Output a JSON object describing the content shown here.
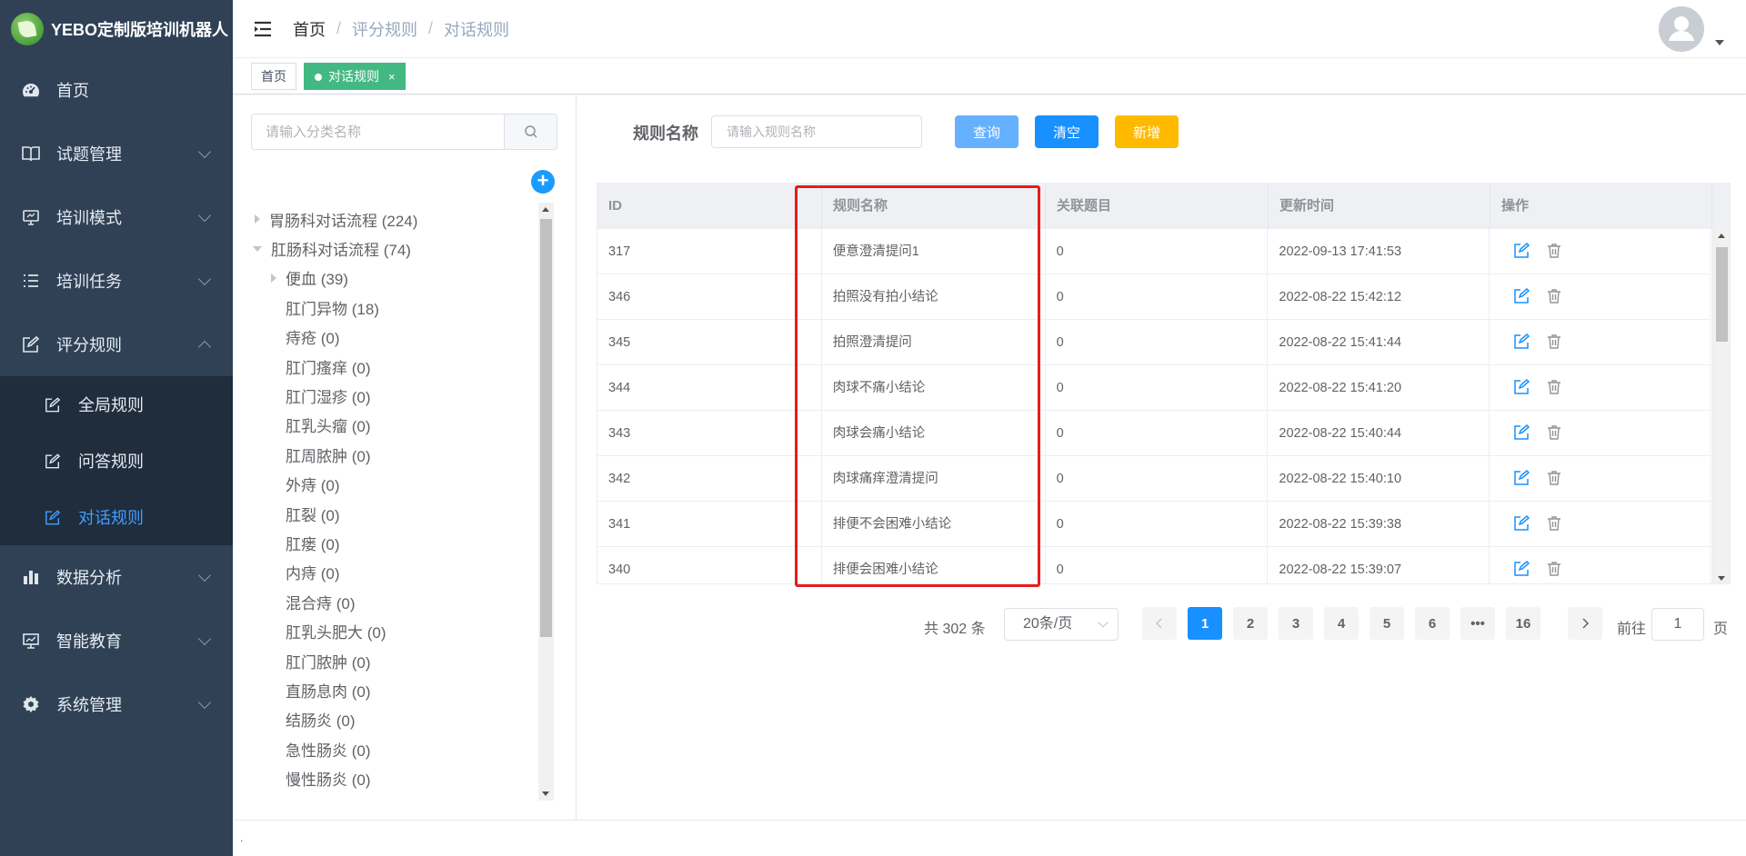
{
  "app": {
    "title": "YEBO定制版培训机器人"
  },
  "sidebar": {
    "items": [
      {
        "label": "首页",
        "icon": "dashboard-icon"
      },
      {
        "label": "试题管理",
        "icon": "book-icon"
      },
      {
        "label": "培训模式",
        "icon": "monitor-icon"
      },
      {
        "label": "培训任务",
        "icon": "list-icon"
      },
      {
        "label": "评分规则",
        "icon": "edit-icon"
      },
      {
        "label": "数据分析",
        "icon": "bar-chart-icon"
      },
      {
        "label": "智能教育",
        "icon": "screen-chart-icon"
      },
      {
        "label": "系统管理",
        "icon": "gear-icon"
      }
    ],
    "submenu": [
      {
        "label": "全局规则"
      },
      {
        "label": "问答规则"
      },
      {
        "label": "对话规则"
      }
    ],
    "active_color": "#409eff"
  },
  "breadcrumb": {
    "home": "首页",
    "sep": "/",
    "level2": "评分规则",
    "level3": "对话规则"
  },
  "tags": {
    "home": "首页",
    "active": "对话规则",
    "close": "×"
  },
  "tree": {
    "search_placeholder": "请输入分类名称",
    "add": "+",
    "nodes": [
      {
        "label": "胃肠科对话流程 (224)",
        "state": "collapsed",
        "level": 1
      },
      {
        "label": "肛肠科对话流程 (74)",
        "state": "expanded",
        "level": 1
      },
      {
        "label": "便血 (39)",
        "state": "collapsed",
        "level": 2
      },
      {
        "label": "肛门异物 (18)",
        "level": 2
      },
      {
        "label": "痔疮 (0)",
        "level": 2
      },
      {
        "label": "肛门瘙痒 (0)",
        "level": 2
      },
      {
        "label": "肛门湿疹 (0)",
        "level": 2
      },
      {
        "label": "肛乳头瘤 (0)",
        "level": 2
      },
      {
        "label": "肛周脓肿 (0)",
        "level": 2
      },
      {
        "label": "外痔 (0)",
        "level": 2
      },
      {
        "label": "肛裂 (0)",
        "level": 2
      },
      {
        "label": "肛瘘 (0)",
        "level": 2
      },
      {
        "label": "内痔 (0)",
        "level": 2
      },
      {
        "label": "混合痔 (0)",
        "level": 2
      },
      {
        "label": "肛乳头肥大 (0)",
        "level": 2
      },
      {
        "label": "肛门脓肿 (0)",
        "level": 2
      },
      {
        "label": "直肠息肉 (0)",
        "level": 2
      },
      {
        "label": "结肠炎 (0)",
        "level": 2
      },
      {
        "label": "急性肠炎 (0)",
        "level": 2
      },
      {
        "label": "慢性肠炎 (0)",
        "level": 2
      }
    ]
  },
  "filter": {
    "label": "规则名称",
    "placeholder": "请输入规则名称",
    "query": "查询",
    "clear": "清空",
    "add": "新增"
  },
  "table": {
    "columns": [
      "ID",
      "规则名称",
      "关联题目",
      "更新时间",
      "操作"
    ],
    "rows": [
      {
        "id": "317",
        "name": "便意澄清提问1",
        "related": "0",
        "time": "2022-09-13 17:41:53"
      },
      {
        "id": "346",
        "name": "拍照没有拍小结论",
        "related": "0",
        "time": "2022-08-22 15:42:12"
      },
      {
        "id": "345",
        "name": "拍照澄清提问",
        "related": "0",
        "time": "2022-08-22 15:41:44"
      },
      {
        "id": "344",
        "name": "肉球不痛小结论",
        "related": "0",
        "time": "2022-08-22 15:41:20"
      },
      {
        "id": "343",
        "name": "肉球会痛小结论",
        "related": "0",
        "time": "2022-08-22 15:40:44"
      },
      {
        "id": "342",
        "name": "肉球痛痒澄清提问",
        "related": "0",
        "time": "2022-08-22 15:40:10"
      },
      {
        "id": "341",
        "name": "排便不会困难小结论",
        "related": "0",
        "time": "2022-08-22 15:39:38"
      },
      {
        "id": "340",
        "name": "排便会困难小结论",
        "related": "0",
        "time": "2022-08-22 15:39:07"
      }
    ]
  },
  "pagination": {
    "total": "共 302 条",
    "page_size": "20条/页",
    "pages": [
      "1",
      "2",
      "3",
      "4",
      "5",
      "6",
      "•••",
      "16"
    ],
    "current": "1",
    "goto_label": "前往",
    "goto_value": "1",
    "goto_suffix": "页"
  },
  "footer": {
    "text": "."
  },
  "colors": {
    "sidebar_bg": "#304156",
    "primary": "#1890ff",
    "tag_active": "#42b983",
    "highlight": "#e81c1c",
    "warning": "#ffba00"
  }
}
